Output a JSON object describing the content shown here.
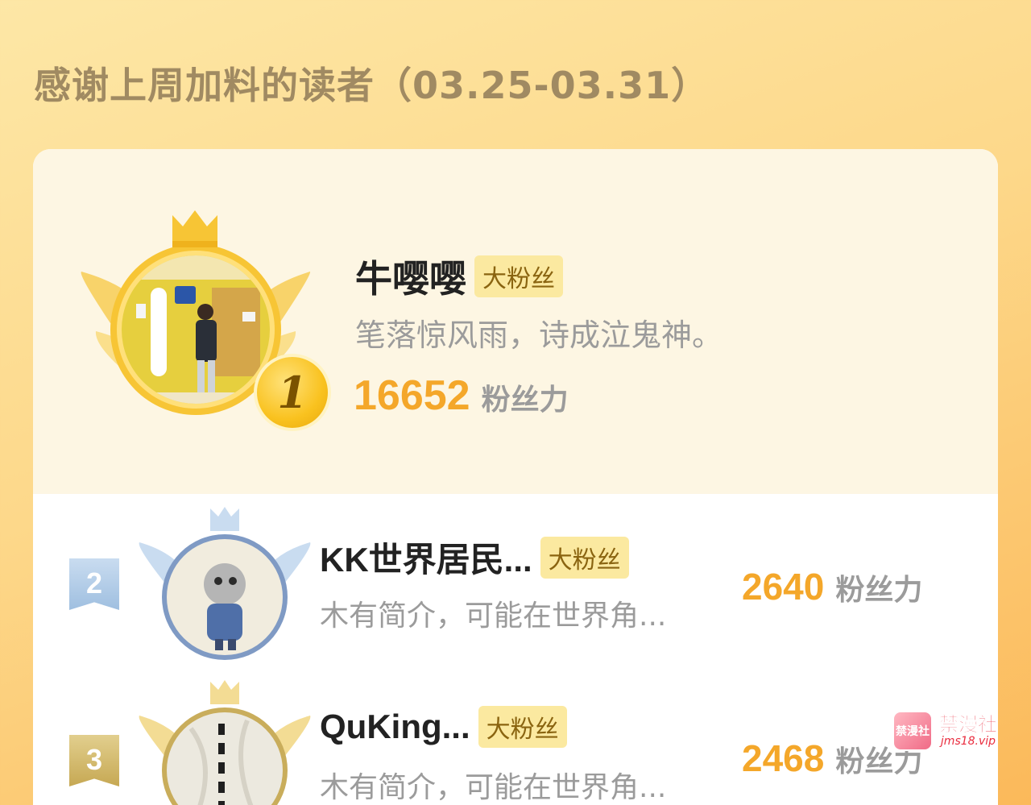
{
  "header": {
    "title": "感谢上周加料的读者（03.25-03.31）"
  },
  "readers": [
    {
      "rank": "1",
      "name": "牛嘤嘤",
      "badge": "大粉丝",
      "bio": "笔落惊风雨，诗成泣鬼神。",
      "score": "16652",
      "score_unit": "粉丝力"
    },
    {
      "rank": "2",
      "name": "KK世界居民...",
      "badge": "大粉丝",
      "bio": "木有简介，可能在世界角...",
      "score": "2640",
      "score_unit": "粉丝力"
    },
    {
      "rank": "3",
      "name": "QuKing...",
      "badge": "大粉丝",
      "bio": "木有简介，可能在世界角...",
      "score": "2468",
      "score_unit": "粉丝力"
    }
  ],
  "watermark": {
    "title": "禁漫社",
    "url": "jms18.vip",
    "logo_text": "禁漫社"
  },
  "colors": {
    "background": "#fdd88a",
    "accent_score": "#f4a72a",
    "title": "#a08a62",
    "badge_bg": "#fbe9a0",
    "rank1_coin": "#f9c21f",
    "rank2_flag": "#9fbfe0",
    "rank3_flag": "#c6a853"
  },
  "icons": [
    "crown-icon",
    "wings-icon",
    "rank-coin-icon",
    "rank-flag-icon"
  ]
}
